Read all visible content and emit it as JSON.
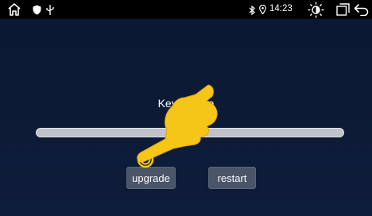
{
  "status_bar": {
    "time": "14:23",
    "icons": [
      "home-icon",
      "shield-icon",
      "usb-icon",
      "bluetooth-icon",
      "location-icon",
      "brightness-icon",
      "recent-apps-icon",
      "back-icon"
    ]
  },
  "main": {
    "title": "Key update",
    "progress": 0,
    "buttons": {
      "upgrade": "upgrade",
      "restart": "restart"
    }
  },
  "overlay": {
    "icon": "pointing-hand-icon",
    "color": "#f5c518"
  }
}
